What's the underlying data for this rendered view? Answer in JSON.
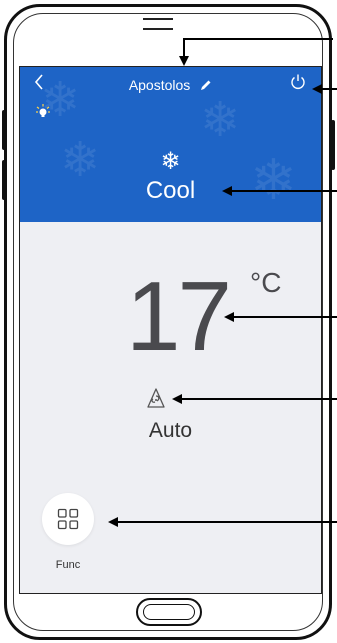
{
  "header": {
    "device_name": "Apostolos",
    "back_icon": "chevron-left-icon",
    "edit_icon": "pencil-icon",
    "power_icon": "power-icon",
    "light_icon": "light-bulb-icon",
    "background_color": "#1e64c6"
  },
  "mode": {
    "icon": "snowflake-icon",
    "label": "Cool"
  },
  "temperature": {
    "value": "17",
    "unit": "°C"
  },
  "fan": {
    "icon": "fan-icon",
    "label": "Auto"
  },
  "func": {
    "icon": "grid-icon",
    "label": "Func"
  },
  "colors": {
    "accent": "#1e64c6",
    "body_bg": "#eeeff3",
    "text": "#4a4a4e"
  }
}
